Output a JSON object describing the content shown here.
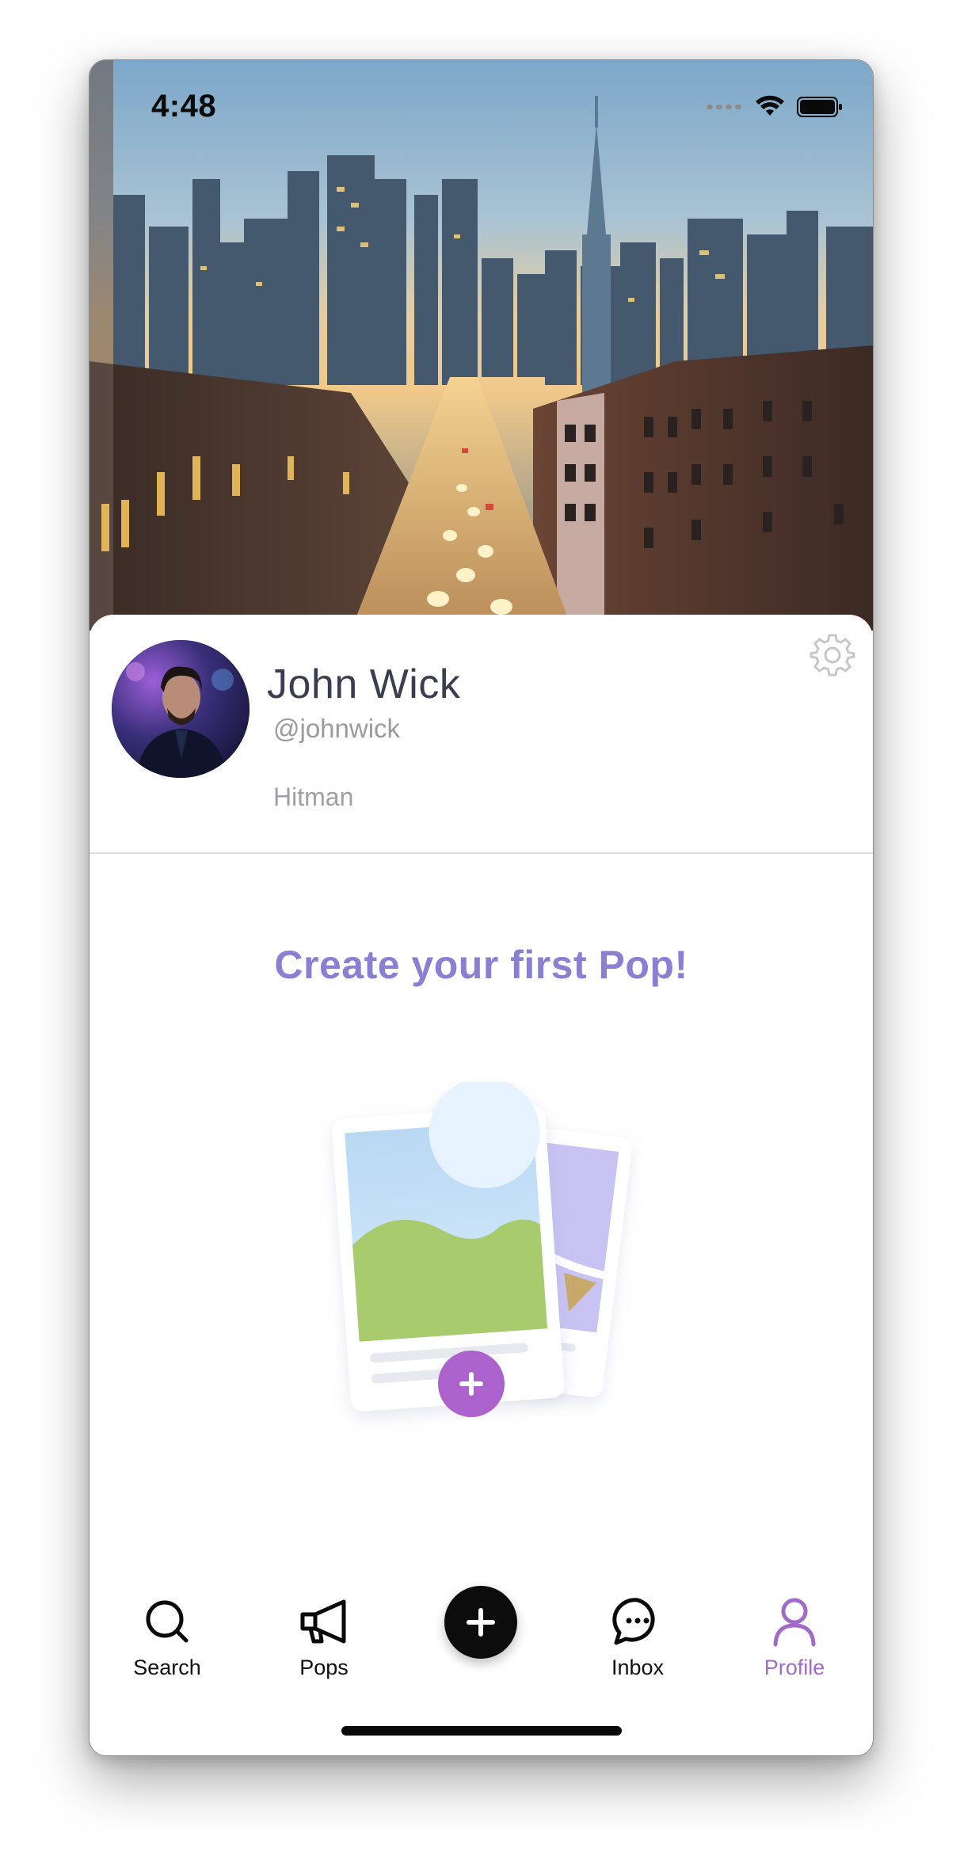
{
  "status_bar": {
    "time": "4:48",
    "icons": [
      "signal-dots-icon",
      "wifi-icon",
      "battery-icon"
    ]
  },
  "cover": {
    "image": "city-street-skyline-photo"
  },
  "profile": {
    "name": "John Wick",
    "handle": "@johnwick",
    "bio": "Hitman",
    "avatar": "avatar-photo",
    "settings_icon": "gear-icon"
  },
  "empty_state": {
    "title": "Create your first Pop!",
    "illustration": "cards-with-plus-illustration",
    "accent_color": "#8b7fd4",
    "plus_color": "#a95fc9"
  },
  "tab_bar": {
    "items": [
      {
        "label": "Search",
        "icon": "search-icon",
        "active": false
      },
      {
        "label": "Pops",
        "icon": "megaphone-icon",
        "active": false
      },
      {
        "label": "Inbox",
        "icon": "chat-bubble-icon",
        "active": false
      },
      {
        "label": "Profile",
        "icon": "person-icon",
        "active": true
      }
    ],
    "create_icon": "plus-icon",
    "active_color": "#a16bc8"
  }
}
